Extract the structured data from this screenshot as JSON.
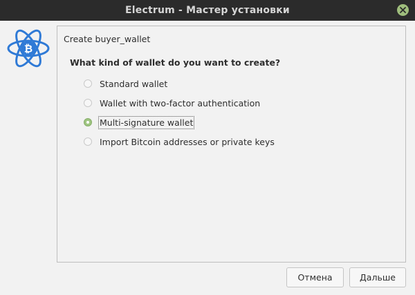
{
  "window": {
    "title": "Electrum  -  Мастер установки",
    "close_icon": "close-icon"
  },
  "logo": {
    "icon": "electrum-bitcoin-atom-icon",
    "color": "#2f7ad6"
  },
  "wizard": {
    "heading": "Create buyer_wallet",
    "question": "What kind of wallet do you want to create?",
    "options": [
      {
        "label": "Standard wallet",
        "checked": false
      },
      {
        "label": "Wallet with two-factor authentication",
        "checked": false
      },
      {
        "label": "Multi-signature wallet",
        "checked": true
      },
      {
        "label": "Import Bitcoin addresses or private keys",
        "checked": false
      }
    ]
  },
  "buttons": {
    "cancel": "Отмена",
    "next": "Дальше"
  },
  "colors": {
    "titlebar": "#2b2b2b",
    "accent": "#9fc582",
    "logo": "#2f7ad6"
  }
}
